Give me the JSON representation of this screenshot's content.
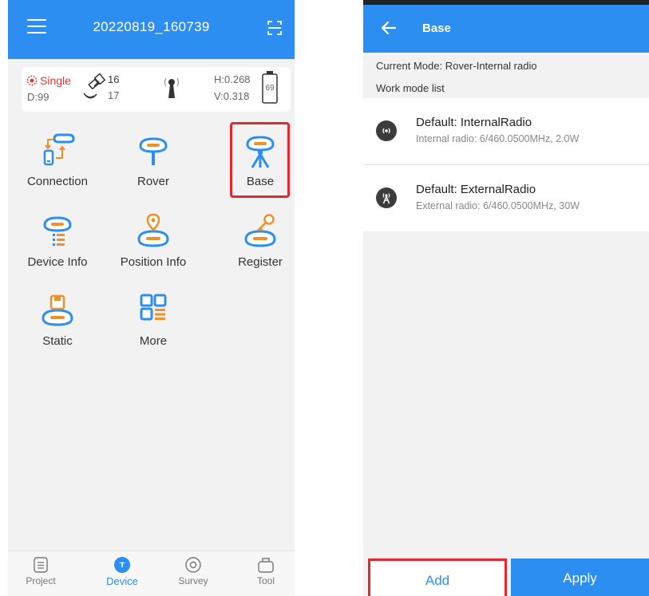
{
  "left": {
    "header": {
      "title": "20220819_160739"
    },
    "status": {
      "solution": "Single",
      "diff_age": "D:99",
      "sats_used": "16",
      "sats_tracked": "17",
      "h_precision": "H:0.268",
      "v_precision": "V:0.318",
      "battery": "69"
    },
    "grid": {
      "connection": "Connection",
      "rover": "Rover",
      "base": "Base",
      "device_info": "Device Info",
      "position_info": "Position Info",
      "register": "Register",
      "static": "Static",
      "more": "More"
    },
    "tabs": {
      "project": "Project",
      "device": "Device",
      "survey": "Survey",
      "tool": "Tool"
    }
  },
  "right": {
    "header": {
      "title": "Base"
    },
    "current_mode": "Current Mode:  Rover-Internal radio",
    "list_label": "Work mode list",
    "modes": [
      {
        "title": "Default: InternalRadio",
        "subtitle": "Internal radio: 6/460.0500MHz, 2.0W"
      },
      {
        "title": "Default: ExternalRadio",
        "subtitle": "External radio: 6/460.0500MHz, 30W"
      }
    ],
    "buttons": {
      "add": "Add",
      "apply": "Apply"
    }
  },
  "colors": {
    "primary": "#2b8ef0",
    "accent_orange": "#f0902a",
    "highlight_red": "#e5262b",
    "status_red": "#e9342e"
  }
}
